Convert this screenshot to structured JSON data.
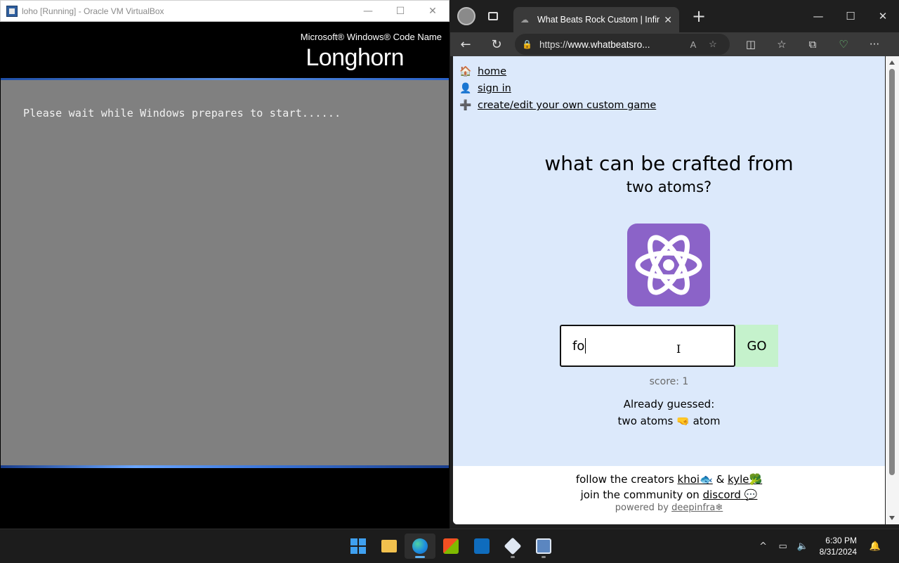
{
  "vbox": {
    "title": "loho [Running] - Oracle VM VirtualBox",
    "controls": {
      "minimize": "—",
      "maximize": "☐",
      "close": "✕"
    },
    "screen": {
      "brand_small": "Microsoft® Windows® Code Name",
      "brand_big": "Longhorn",
      "message": "Please wait while Windows prepares to start......"
    }
  },
  "edge": {
    "tab": {
      "label": "What Beats Rock Custom | Infinite",
      "close": "✕"
    },
    "newtab": "+",
    "window_controls": {
      "minimize": "—",
      "maximize": "☐",
      "close": "✕"
    },
    "nav": {
      "back": "←",
      "refresh": "↻"
    },
    "address": {
      "prefix": "https://",
      "host": "www.whatbeatsro...",
      "read_aloud": "A",
      "favorite": "☆"
    },
    "toolbar_icons": [
      "split-screen-icon",
      "favorites-icon",
      "collections-icon",
      "extension-icon",
      "more-icon"
    ],
    "toolbar_glyphs": [
      "◫",
      "☆",
      "⧉",
      "♡",
      "···"
    ]
  },
  "page": {
    "nav": [
      {
        "emoji": "🏠",
        "label": "home"
      },
      {
        "emoji": "👤",
        "label": "sign in"
      },
      {
        "emoji": "➕",
        "label": "create/edit your own custom game"
      }
    ],
    "question_line1": "what can be crafted from",
    "question_line2": "two atoms?",
    "input_value": "fo",
    "go_label": "GO",
    "score": "score: 1",
    "already_guessed": "Already guessed:",
    "guessed_left": "two atoms",
    "guessed_emoji": "🤜",
    "guessed_right": "atom",
    "footer": {
      "follow_text": "follow the creators",
      "khoi": "khoi",
      "khoi_emoji": "🐟",
      "amp": "&",
      "kyle": "kyle",
      "kyle_emoji": "🥦",
      "join_text": "join the community on",
      "discord": "discord",
      "discord_emoji": "💬",
      "powered_text": "powered by",
      "deepinfra": "deepinfra",
      "deepinfra_emoji": "❄"
    },
    "colors": {
      "background": "#dce9fb",
      "atom_tile": "#8b63c8",
      "go_button": "#c5f2cc"
    }
  },
  "taskbar": {
    "apps": [
      "start-icon",
      "file-explorer-icon",
      "edge-icon",
      "store-icon",
      "outlook-icon",
      "virtualbox-icon",
      "vm-window-icon"
    ],
    "tray": {
      "chevron": "^"
    },
    "time": "6:30 PM",
    "date": "8/31/2024"
  }
}
